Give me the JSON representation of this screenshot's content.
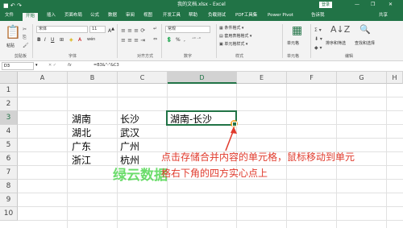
{
  "window": {
    "title": "我的文档.xlsx - Excel",
    "login_label": "登录",
    "minimize": "—",
    "restore": "❐",
    "close": "✕"
  },
  "quick_access": {
    "save_icon": "save-icon",
    "undo": "↶",
    "redo": "↷"
  },
  "tabs": [
    {
      "label": "文件"
    },
    {
      "label": "开始",
      "active": true
    },
    {
      "label": "插入"
    },
    {
      "label": "页面布局"
    },
    {
      "label": "公式"
    },
    {
      "label": "数据"
    },
    {
      "label": "审阅"
    },
    {
      "label": "视图"
    },
    {
      "label": "开发工具"
    },
    {
      "label": "帮助"
    },
    {
      "label": "负载测试"
    },
    {
      "label": "PDF工具集"
    },
    {
      "label": "Power Pivot"
    },
    {
      "label": "告诉我"
    },
    {
      "label": "共享"
    }
  ],
  "ribbon": {
    "paste_label": "粘贴",
    "font_name": "宋体",
    "font_size": "11",
    "bold": "B",
    "italic": "I",
    "underline": "U",
    "wen": "wén",
    "number_format": "常规",
    "percent": "%",
    "comma": ",",
    "cond_format": "条件格式",
    "table_format": "套用表格格式",
    "cell_style": "单元格样式",
    "cells_label": "单元格",
    "sort_filter": "排序和筛选",
    "find_select": "查找和选择",
    "groups": {
      "clipboard": "剪贴板",
      "font": "字体",
      "alignment": "对齐方式",
      "number": "数字",
      "styles": "样式",
      "cells": "单元格",
      "editing": "编辑"
    }
  },
  "formula_bar": {
    "name_box": "D3",
    "fx": "fx",
    "formula": "=B3&\"-\"&C3"
  },
  "sheet": {
    "columns": [
      "A",
      "B",
      "C",
      "D",
      "E",
      "F",
      "G",
      "H"
    ],
    "rows": [
      "1",
      "2",
      "3",
      "4",
      "5",
      "6",
      "7",
      "8",
      "9",
      "10"
    ],
    "cells": {
      "B3": "湖南",
      "C3": "长沙",
      "D3": "湖南-长沙",
      "B4": "湖北",
      "C4": "武汉",
      "B5": "广东",
      "C5": "广州",
      "B6": "浙江",
      "C6": "杭州"
    }
  },
  "annotation": {
    "line1": "点击存储合并内容的单元格，鼠标移动到单元",
    "line2": "格右下角的四方实心点上"
  },
  "watermark": "绿云数据"
}
